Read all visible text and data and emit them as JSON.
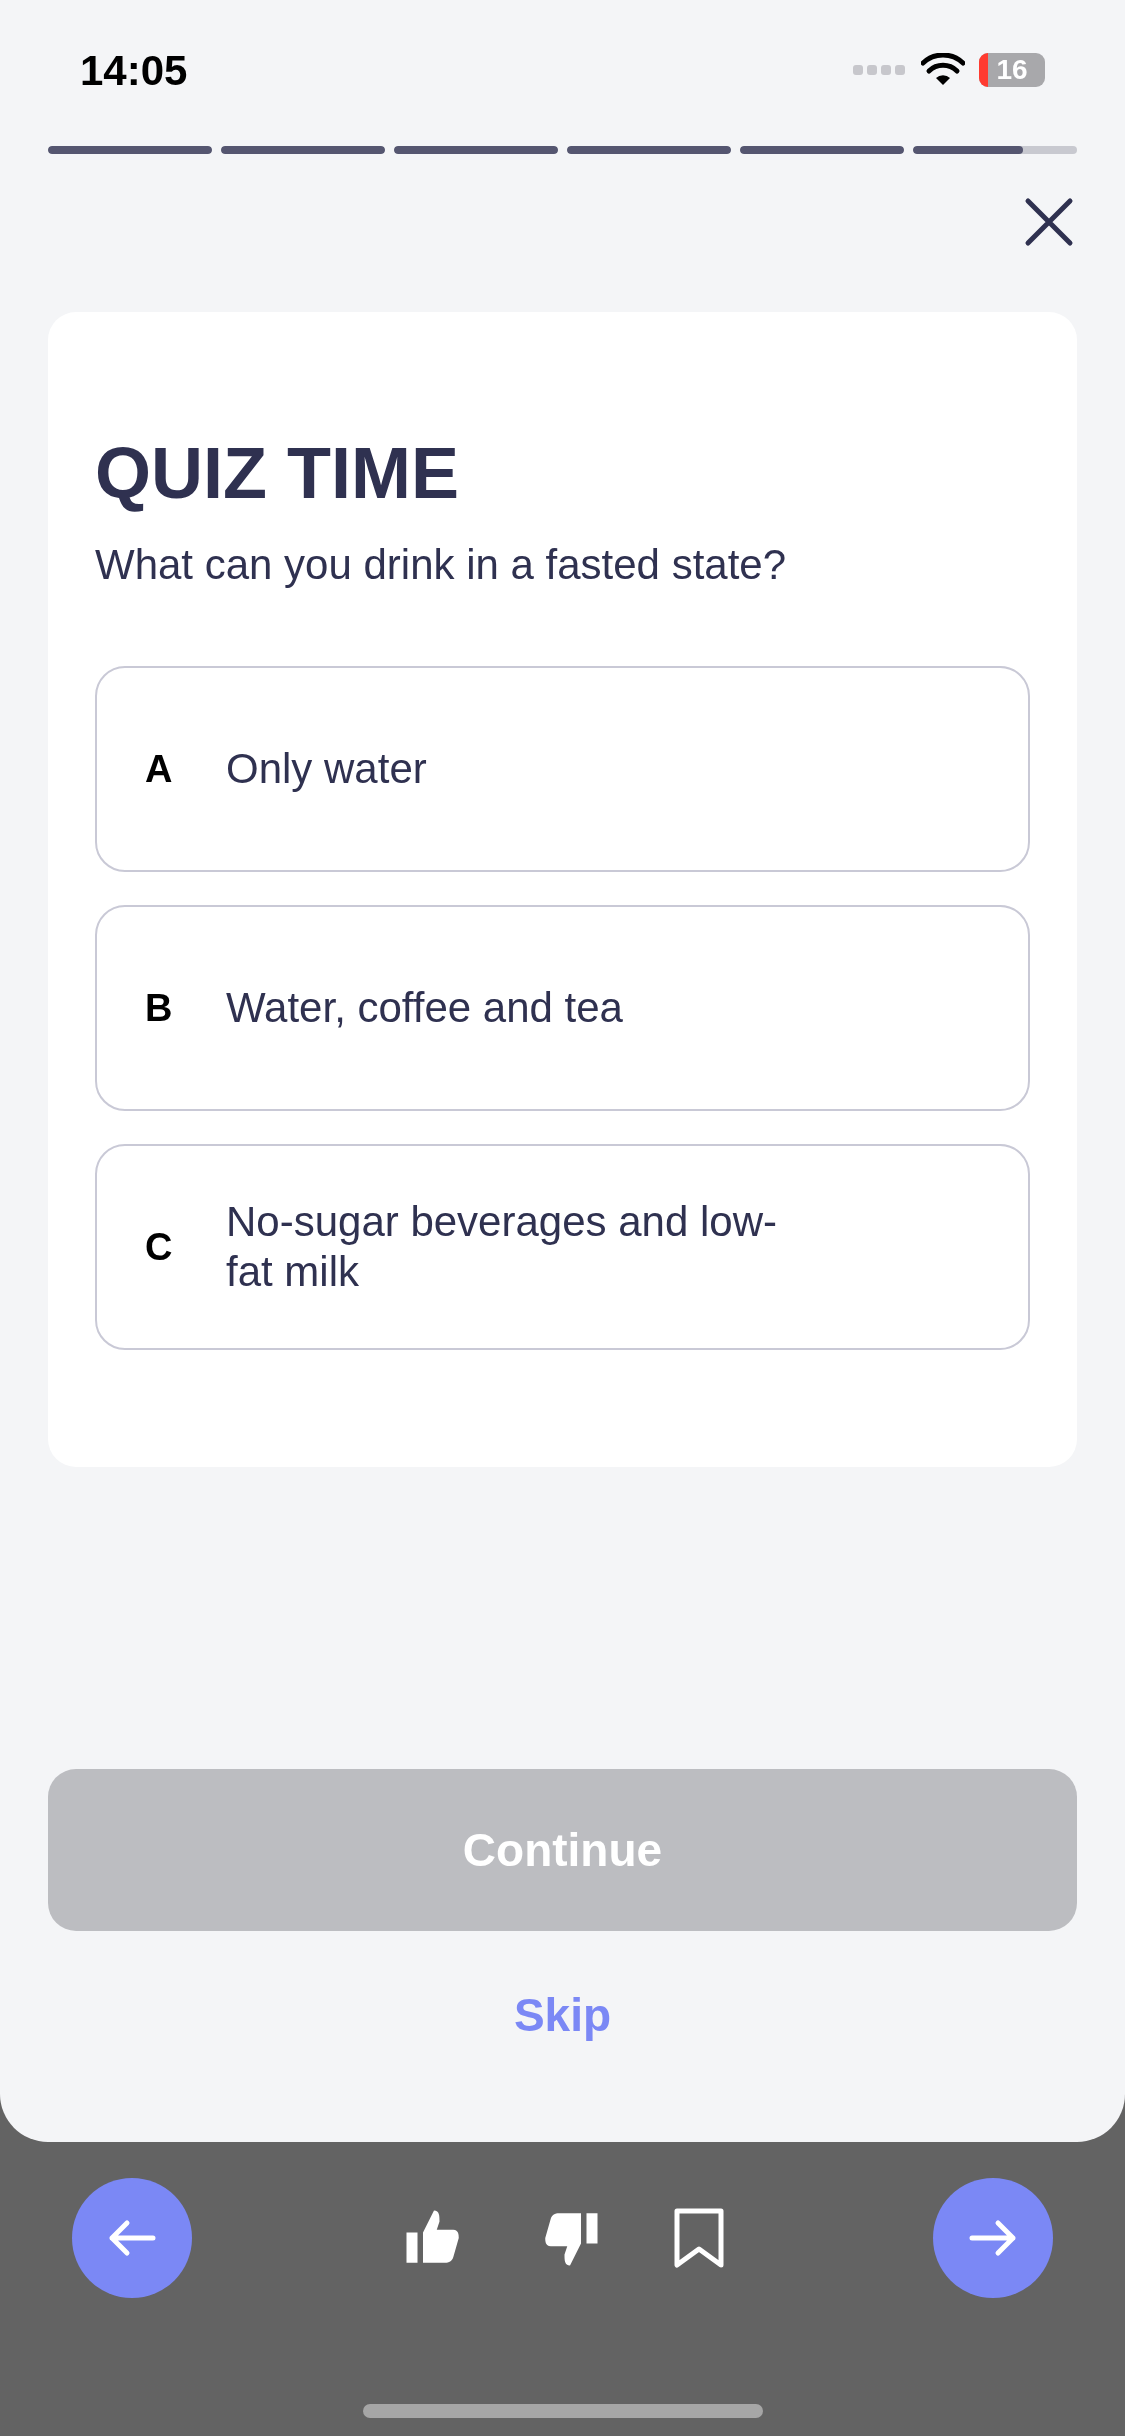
{
  "status_bar": {
    "time": "14:05",
    "battery": "16"
  },
  "progress": [
    {
      "level": 1
    },
    {
      "level": 1
    },
    {
      "level": 1
    },
    {
      "level": 1
    },
    {
      "level": 1
    },
    {
      "level": 0.67
    }
  ],
  "quiz": {
    "title": "QUIZ TIME",
    "question": "What can you drink in a fasted state?",
    "options": [
      {
        "letter": "A",
        "text": "Only water",
        "selected": false
      },
      {
        "letter": "B",
        "text": "Water, coffee and tea",
        "selected": false
      },
      {
        "letter": "C",
        "text": "No-sugar beverages and low-fat milk",
        "selected": false
      }
    ]
  },
  "continue": {
    "label": "Continue",
    "disabled": true
  },
  "skip": {
    "label": "Skip"
  }
}
